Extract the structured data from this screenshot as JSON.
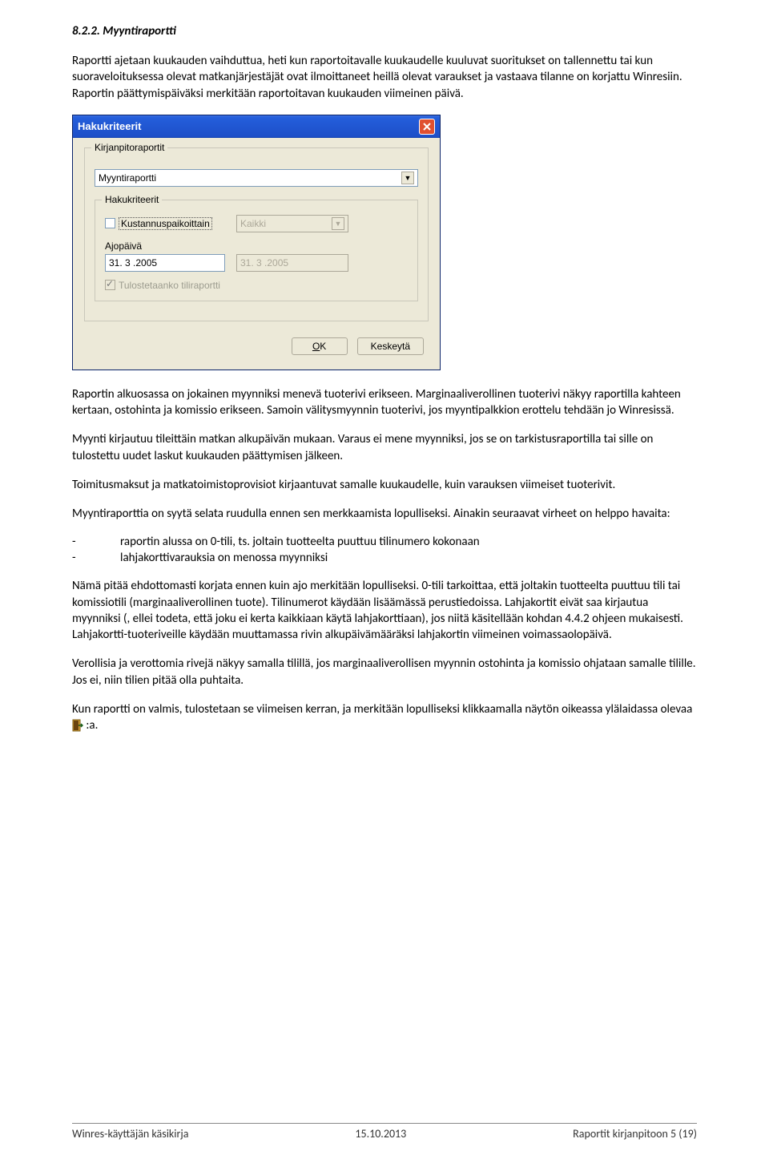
{
  "section_number": "8.2.2. Myyntiraportti",
  "intro_para": "Raportti ajetaan kuukauden vaihduttua, heti kun raportoitavalle kuukaudelle kuuluvat suoritukset on tallennettu tai kun suoraveloituksessa olevat matkanjärjestäjät ovat ilmoittaneet heillä olevat varaukset ja vastaava tilanne on korjattu Winresiin. Raportin päättymispäiväksi merkitään raportoitavan kuukauden viimeinen päivä.",
  "dialog": {
    "title": "Hakukriteerit",
    "tab_label": "Kirjanpitoraportit",
    "report_dropdown": "Myyntiraportti",
    "inner_group_label": "Hakukriteerit",
    "chk_kustannuspaikoittain": "Kustannuspaikoittain",
    "kaikki": "Kaikki",
    "ajopaiva_label": "Ajopäivä",
    "date1": "31. 3 .2005",
    "date2": "31. 3 .2005",
    "chk_tiliraportti": "Tulostetaanko tiliraportti",
    "btn_ok": "OK",
    "btn_cancel": "Keskeytä"
  },
  "p_after1": "Raportin alkuosassa on jokainen myynniksi menevä tuoterivi erikseen. Marginaaliverollinen tuoterivi näkyy raportilla kahteen kertaan, ostohinta ja komissio erikseen. Samoin välitysmyynnin tuoterivi, jos myyntipalkkion erottelu tehdään jo Winresissä.",
  "p_after2": "Myynti kirjautuu tileittäin matkan alkupäivän mukaan. Varaus ei mene myynniksi, jos se on tarkistusraportilla tai sille on tulostettu uudet laskut kuukauden päättymisen jälkeen.",
  "p_after3": "Toimitusmaksut ja matkatoimistoprovisiot kirjaantuvat samalle kuukaudelle, kuin varauksen viimeiset tuoterivit.",
  "p_after4": "Myyntiraporttia on syytä selata ruudulla ennen sen merkkaamista lopulliseksi. Ainakin seuraavat virheet on helppo havaita:",
  "bullet1": "raportin alussa on 0-tili, ts. joltain tuotteelta puuttuu tilinumero kokonaan",
  "bullet2": "lahjakorttivarauksia on menossa myynniksi",
  "p_after5": "Nämä pitää ehdottomasti korjata ennen kuin ajo merkitään lopulliseksi. 0-tili tarkoittaa, että joltakin tuotteelta puuttuu tili tai komissiotili (marginaaliverollinen tuote). Tilinumerot käydään lisäämässä perustiedoissa. Lahjakortit eivät saa kirjautua myynniksi (, ellei todeta, että joku ei kerta kaikkiaan käytä lahjakorttiaan), jos niitä käsitellään kohdan 4.4.2 ohjeen mukaisesti. Lahjakortti-tuoteriveille käydään muuttamassa rivin alkupäivämääräksi lahjakortin viimeinen voimassaolopäivä.",
  "p_after6": "Verollisia ja verottomia rivejä näkyy samalla tilillä, jos marginaaliverollisen myynnin ostohinta ja komissio ohjataan samalle tilille. Jos ei, niin tilien pitää olla puhtaita.",
  "p_after7_a": "Kun raportti on valmis, tulostetaan se viimeisen kerran, ja merkitään lopulliseksi klikkaamalla näytön oikeassa ylälaidassa olevaa ",
  "p_after7_b": ":a.",
  "footer": {
    "left": "Winres-käyttäjän käsikirja",
    "center": "15.10.2013",
    "right": "Raportit kirjanpitoon 5 (19)"
  }
}
